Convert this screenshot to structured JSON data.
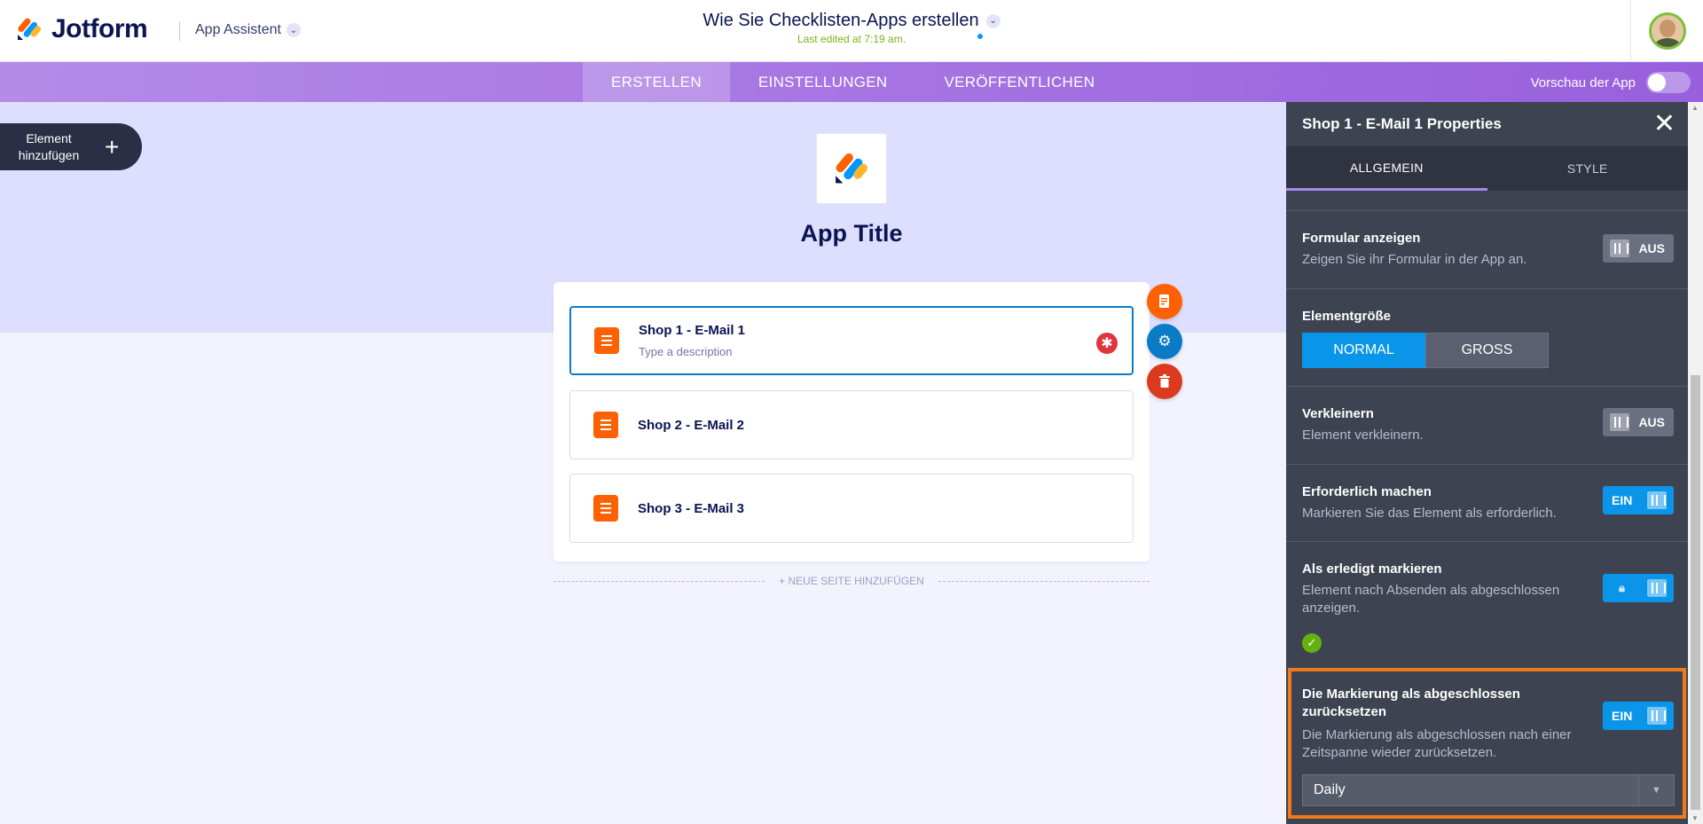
{
  "header": {
    "logo_text": "Jotform",
    "app_assistant": "App Assistent",
    "doc_title": "Wie Sie Checklisten-Apps erstellen",
    "last_edited": "Last edited at 7:19 am."
  },
  "nav": {
    "tabs": [
      {
        "label": "ERSTELLEN",
        "active": true
      },
      {
        "label": "EINSTELLUNGEN",
        "active": false
      },
      {
        "label": "VERÖFFENTLICHEN",
        "active": false
      }
    ],
    "preview_label": "Vorschau der App"
  },
  "canvas": {
    "add_element_label": "Element hinzufügen",
    "app_title": "App Title",
    "items": [
      {
        "name": "Shop 1 - E-Mail 1",
        "description": "Type a description"
      },
      {
        "name": "Shop 2 - E-Mail 2"
      },
      {
        "name": "Shop 3 - E-Mail 3"
      }
    ],
    "new_page": "+ NEUE SEITE HINZUFÜGEN"
  },
  "props": {
    "title": "Shop 1 - E-Mail 1 Properties",
    "tabs": [
      "ALLGEMEIN",
      "STYLE"
    ],
    "sections": {
      "show_form": {
        "label": "Formular anzeigen",
        "desc": "Zeigen Sie ihr Formular in der App an.",
        "state": "AUS"
      },
      "size": {
        "label": "Elementgröße",
        "options": [
          "NORMAL",
          "GROSS"
        ]
      },
      "shrink": {
        "label": "Verkleinern",
        "desc": "Element verkleinern.",
        "state": "AUS"
      },
      "required": {
        "label": "Erforderlich machen",
        "desc": "Markieren Sie das Element als erforderlich.",
        "state": "EIN"
      },
      "mark_done": {
        "label": "Als erledigt markieren",
        "desc": "Element nach Absenden als abgeschlossen anzeigen."
      },
      "reset": {
        "label": "Die Markierung als abgeschlossen zurücksetzen",
        "desc": "Die Markierung als abgeschlossen nach einer Zeitspanne wieder zurücksetzen.",
        "state": "EIN",
        "select_value": "Daily"
      }
    }
  },
  "colors": {
    "accent": "#0a95e8",
    "orange": "#ff6100",
    "purple": "#9860dc",
    "highlight": "#f07a1a"
  }
}
